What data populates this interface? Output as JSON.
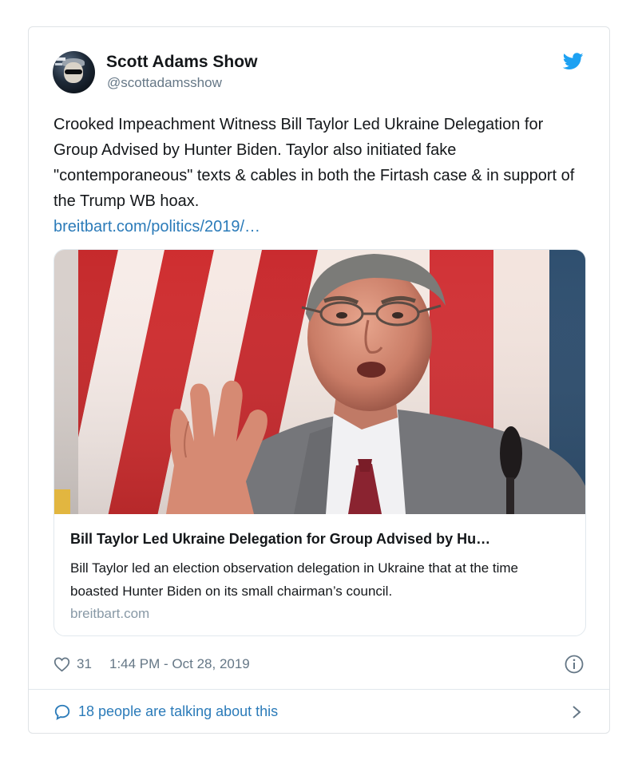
{
  "tweet": {
    "author_name": "Scott Adams Show",
    "author_handle": "@scottadamsshow",
    "text": "Crooked Impeachment Witness Bill Taylor Led Ukraine Delegation for Group Advised by Hunter Biden. Taylor also initiated fake \"contemporaneous\" texts & cables in both the Firtash case & in support of the Trump WB hoax.",
    "link_text": "breitbart.com/politics/2019/…",
    "likes": "31",
    "timestamp": "1:44 PM - Oct 28, 2019",
    "conversation": "18 people are talking about this"
  },
  "link_card": {
    "title": "Bill Taylor Led Ukraine Delegation for Group Advised by Hu…",
    "description": "Bill Taylor led an election observation delegation in Ukraine that at the time boasted Hunter Biden on its small chairman’s council.",
    "domain": "breitbart.com"
  },
  "icons": {
    "brand": "twitter-bird-icon",
    "like": "heart-icon",
    "info": "info-icon",
    "conversation": "speech-bubble-icon",
    "more": "chevron-right-icon"
  },
  "colors": {
    "link": "#2b7bb9",
    "twitter_blue": "#1da1f2",
    "secondary_text": "#657786",
    "border": "#e1e8ed"
  }
}
